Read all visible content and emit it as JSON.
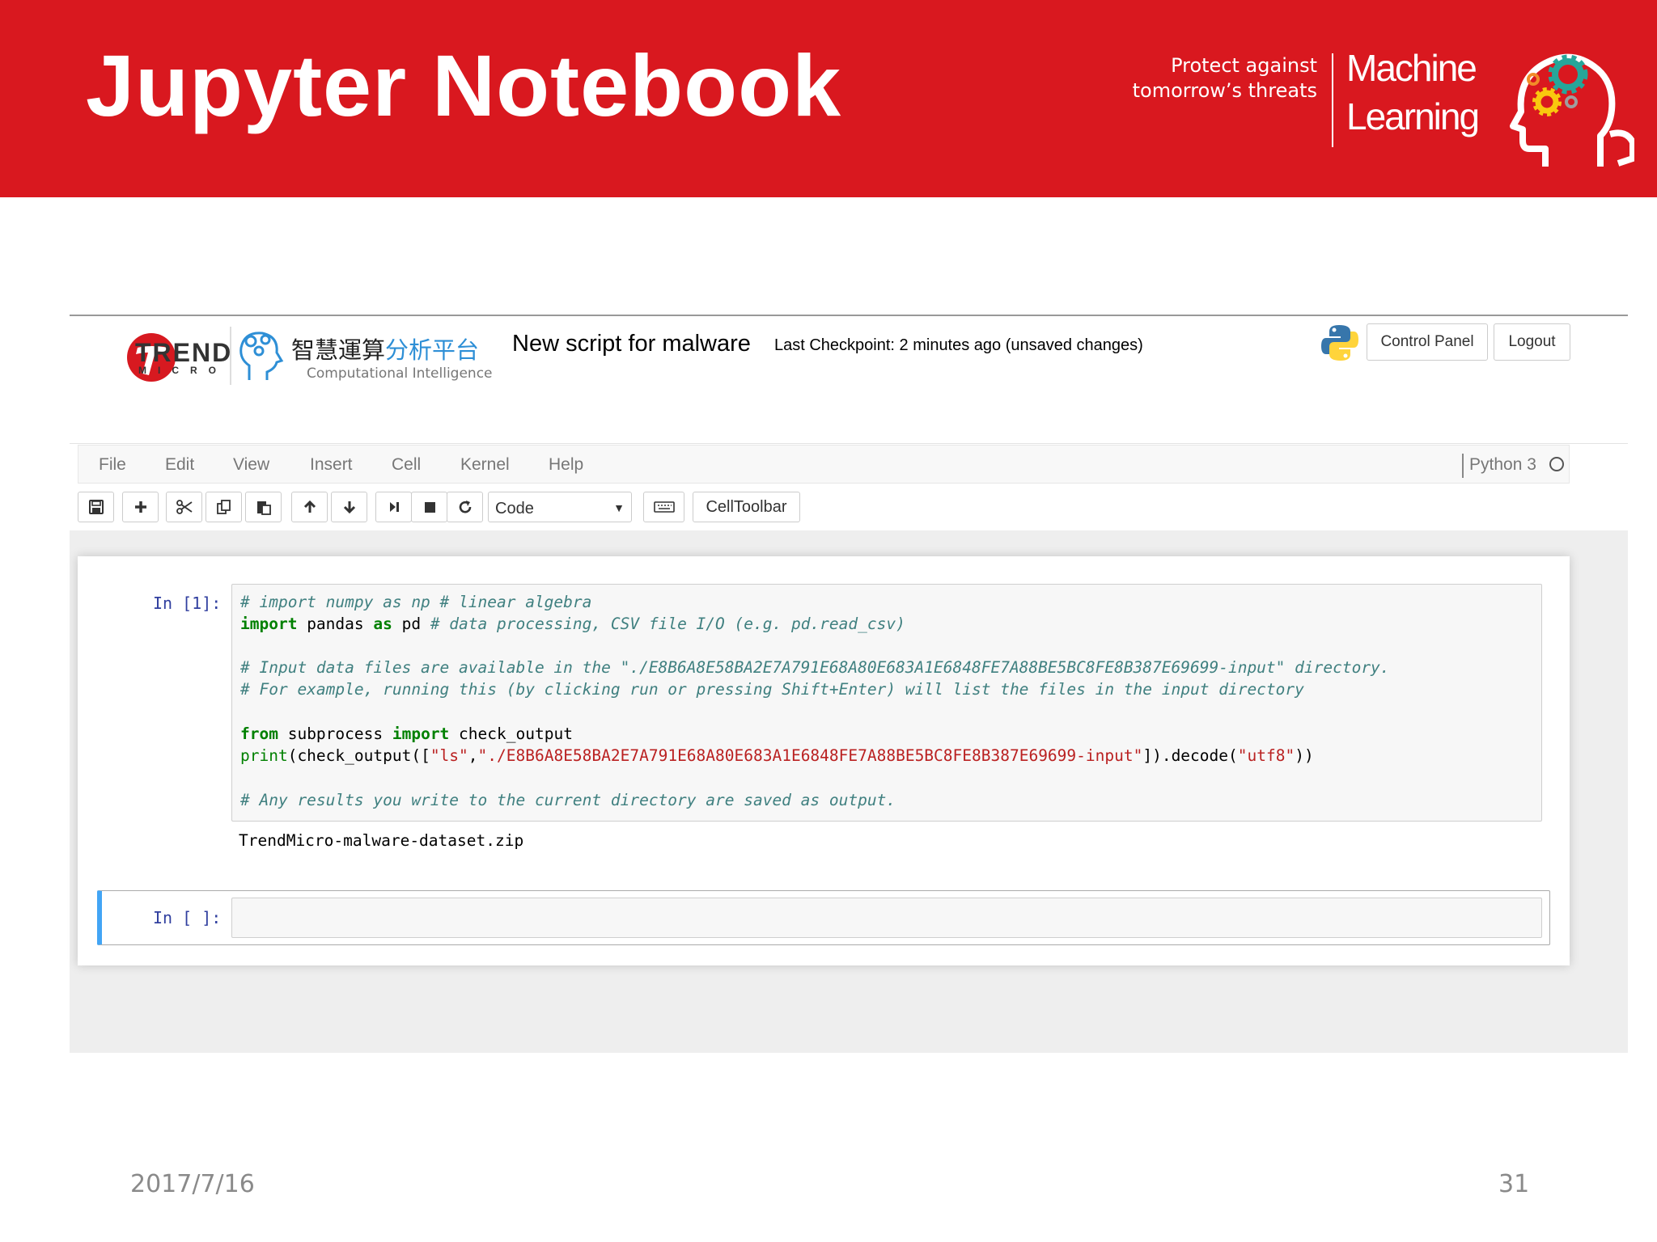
{
  "slide": {
    "title": "Jupyter Notebook",
    "tagline": "Protect against tomorrow’s threats",
    "ml_line1": "Machine",
    "ml_line2": "Learning",
    "date": "2017/7/16",
    "page": "31",
    "colors": {
      "banner": "#d9181f",
      "text_on_banner": "#ffffff"
    }
  },
  "header": {
    "brand": "TREND",
    "brand_sub": "MICRO",
    "ci_title_black": "智慧運算",
    "ci_title_blue": "分析平台",
    "ci_sub": "Computational Intelligence",
    "notebook_name": "New script for malware",
    "checkpoint": "Last Checkpoint: 2 minutes ago (unsaved changes)",
    "control_panel": "Control Panel",
    "logout": "Logout"
  },
  "menubar": {
    "items": [
      "File",
      "Edit",
      "View",
      "Insert",
      "Cell",
      "Kernel",
      "Help"
    ],
    "kernel": "Python 3"
  },
  "toolbar": {
    "icons": [
      "save-icon",
      "plus-icon",
      "cut-icon",
      "copy-icon",
      "paste-icon",
      "arrow-up-icon",
      "arrow-down-icon",
      "step-forward-icon",
      "stop-icon",
      "refresh-icon",
      "keyboard-icon"
    ],
    "cell_type": "Code",
    "celltoolbar": "CellToolbar"
  },
  "cells": {
    "cell1": {
      "prompt": "In [1]:",
      "lines": {
        "l1": "# import numpy as np # linear algebra",
        "l2_kw1": "import",
        "l2_mod": " pandas ",
        "l2_kw2": "as",
        "l2_alias": " pd ",
        "l2_comment": "# data processing, CSV file I/O (e.g. pd.read_csv)",
        "l3": "# Input data files are available in the \"./E8B6A8E58BA2E7A791E68A80E683A1E6848FE7A88BE5BC8FE8B387E69699-input\" directory.",
        "l4": "# For example, running this (by clicking run or pressing Shift+Enter) will list the files in the input directory",
        "l5_kw1": "from",
        "l5_mod": " subprocess ",
        "l5_kw2": "import",
        "l5_name": " check_output",
        "l6_print": "print",
        "l6_a": "(check_output([",
        "l6_s1": "\"ls\"",
        "l6_b": ",",
        "l6_s2": "\"./E8B6A8E58BA2E7A791E68A80E683A1E6848FE7A88BE5BC8FE8B387E69699-input\"",
        "l6_c": "]).decode(",
        "l6_s3": "\"utf8\"",
        "l6_d": "))",
        "l7": "# Any results you write to the current directory are saved as output."
      },
      "output": "TrendMicro-malware-dataset.zip"
    },
    "cell2": {
      "prompt": "In [ ]:"
    },
    "colors": {
      "prompt": "#303f9f",
      "selected_border": "#42a5f5",
      "comment": "#408080",
      "keyword": "#008000",
      "string": "#ba2121"
    }
  }
}
